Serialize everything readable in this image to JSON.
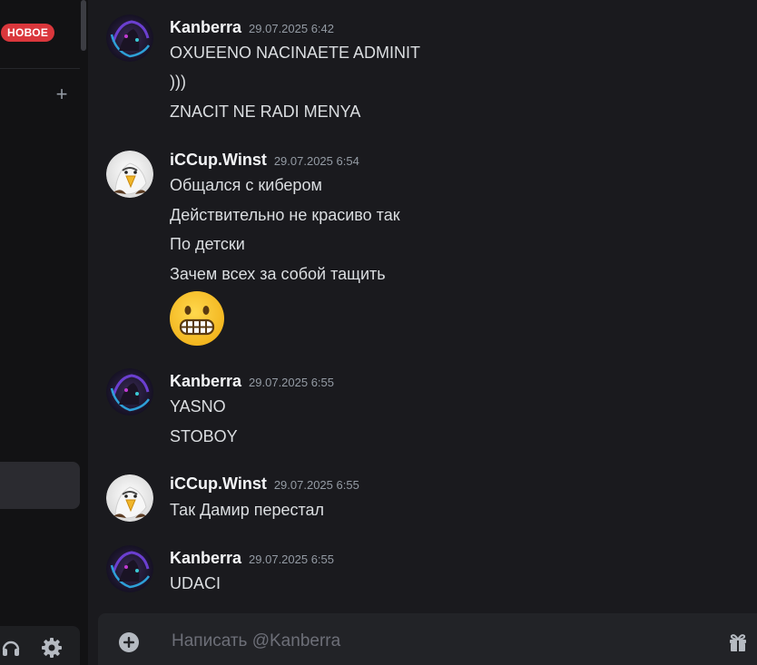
{
  "sidebar": {
    "new_badge": "НОВОЕ",
    "add_dm_label": "+"
  },
  "messages": [
    {
      "author": "Kanberra",
      "timestamp": "29.07.2025 6:42",
      "avatar": "kanberra-avatar",
      "lines": [
        "OXUEENO NACINAETE ADMINIT",
        ")))",
        "ZNACIT NE RADI MENYA"
      ]
    },
    {
      "author": "iCCup.Winst",
      "timestamp": "29.07.2025 6:54",
      "avatar": "eagle-avatar",
      "lines": [
        "Общался с кибером",
        "Действительно не красиво так",
        "По детски",
        "Зачем всех за собой тащить"
      ],
      "emoji": "grimacing-face-emoji"
    },
    {
      "author": "Kanberra",
      "timestamp": "29.07.2025 6:55",
      "avatar": "kanberra-avatar",
      "lines": [
        "YASNO",
        "STOBOY"
      ]
    },
    {
      "author": "iCCup.Winst",
      "timestamp": "29.07.2025 6:55",
      "avatar": "eagle-avatar",
      "lines": [
        "Так Дамир перестал"
      ]
    },
    {
      "author": "Kanberra",
      "timestamp": "29.07.2025 6:55",
      "avatar": "kanberra-avatar",
      "lines": [
        "UDACI"
      ]
    }
  ],
  "composer": {
    "placeholder": "Написать @Kanberra"
  },
  "colors": {
    "background": "#1a1a1e",
    "sidebar": "#121214",
    "badge": "#da373c",
    "author": "#f2f3f5",
    "timestamp": "#949ba4"
  }
}
